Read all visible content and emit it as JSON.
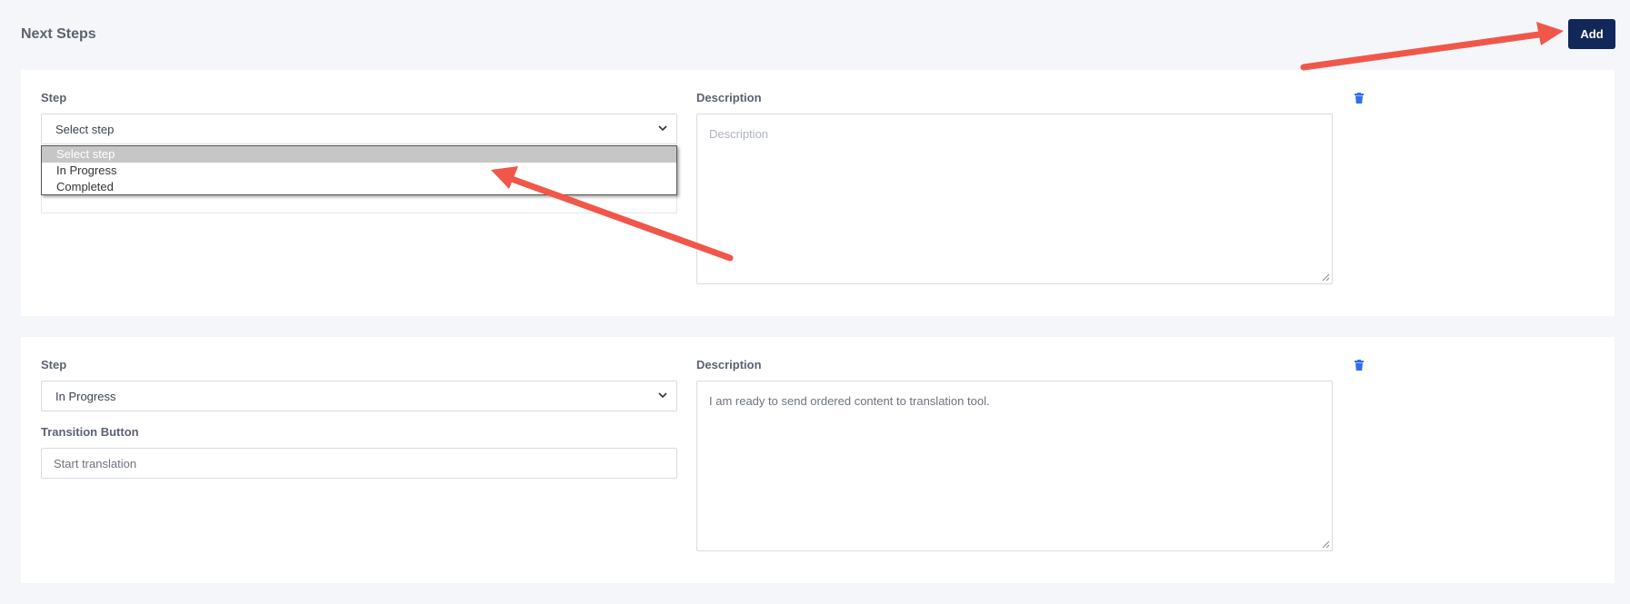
{
  "header": {
    "title": "Next Steps",
    "add_label": "Add"
  },
  "colors": {
    "primary": "#12285a",
    "accent_icon": "#2f6fef",
    "annotation_arrow": "#f0574a"
  },
  "steps": [
    {
      "step_label": "Step",
      "step_value": "Select step",
      "description_label": "Description",
      "description_placeholder": "Description",
      "description_value": "",
      "dropdown_open": true,
      "dropdown_options": [
        "Select step",
        "In Progress",
        "Completed"
      ],
      "dropdown_highlighted": "Select step",
      "delete_icon": "trash-icon"
    },
    {
      "step_label": "Step",
      "step_value": "In Progress",
      "transition_label": "Transition Button",
      "transition_value": "Start translation",
      "description_label": "Description",
      "description_value": "I am ready to send ordered content to translation tool.",
      "delete_icon": "trash-icon"
    }
  ],
  "annotations": {
    "arrow_count": 2
  }
}
